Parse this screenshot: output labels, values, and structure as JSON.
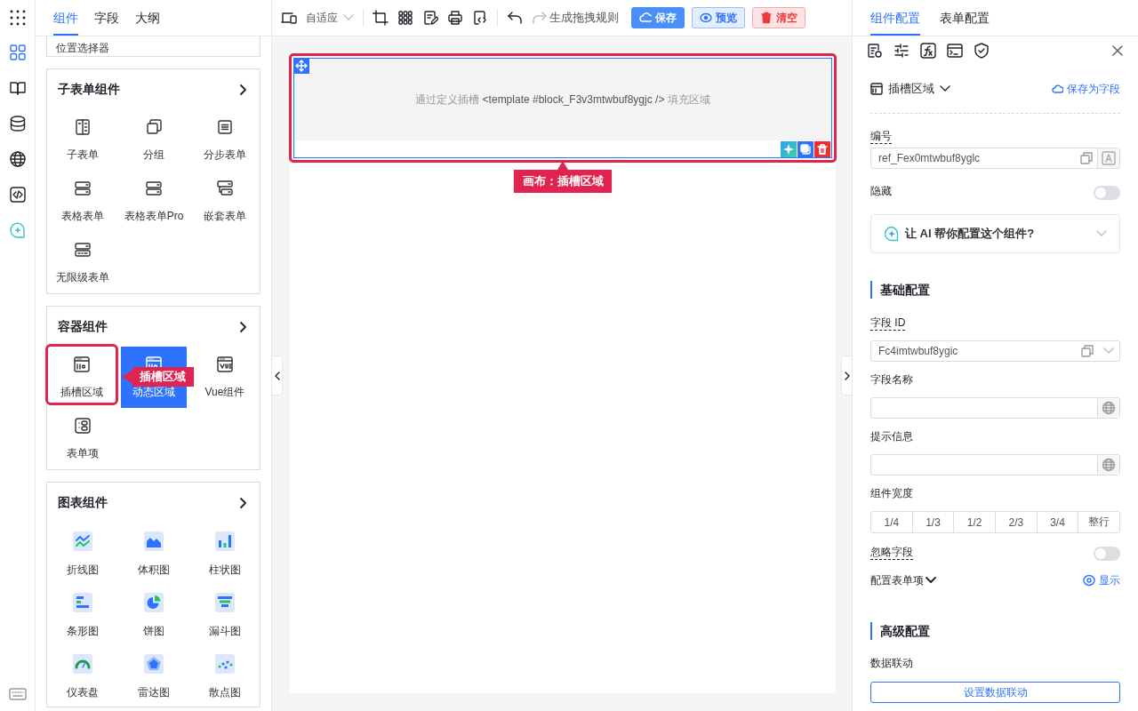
{
  "rail": [
    {
      "selected": true
    },
    {
      "selected": false
    },
    {
      "selected": false
    },
    {
      "selected": false
    },
    {
      "selected": false
    },
    {
      "selected": false
    }
  ],
  "left_tabs": [
    {
      "label": "组件",
      "selected": true
    },
    {
      "label": "字段",
      "selected": false
    },
    {
      "label": "大纲",
      "selected": false
    }
  ],
  "partial_card": {
    "label": "位置选择器"
  },
  "groups": [
    {
      "title": "子表单组件",
      "items": [
        {
          "label": "子表单",
          "selected": false
        },
        {
          "label": "分组",
          "selected": false
        },
        {
          "label": "分步表单",
          "selected": false
        },
        {
          "label": "表格表单",
          "selected": false
        },
        {
          "label": "表格表单Pro",
          "selected": false
        },
        {
          "label": "嵌套表单",
          "selected": false
        },
        {
          "label": "无限级表单",
          "selected": false
        }
      ]
    },
    {
      "title": "容器组件",
      "items": [
        {
          "label": "插槽区域",
          "selected": false,
          "callout": "插槽区域"
        },
        {
          "label": "动态区域",
          "selected": true
        },
        {
          "label": "Vue组件",
          "selected": false
        },
        {
          "label": "表单项",
          "selected": false
        }
      ]
    },
    {
      "title": "图表组件",
      "items": [
        {
          "label": "折线图",
          "selected": false
        },
        {
          "label": "体积图",
          "selected": false
        },
        {
          "label": "柱状图",
          "selected": false
        },
        {
          "label": "条形图",
          "selected": false
        },
        {
          "label": "饼图",
          "selected": false
        },
        {
          "label": "漏斗图",
          "selected": false
        },
        {
          "label": "仪表盘",
          "selected": false
        },
        {
          "label": "雷达图",
          "selected": false
        },
        {
          "label": "散点图",
          "selected": false
        }
      ]
    }
  ],
  "toolbar": {
    "view_mode": "自适应",
    "redo_disabled": true,
    "rule_label": "生成拖拽规则",
    "buttons": [
      {
        "kind": "primary",
        "label": "保存"
      },
      {
        "kind": "info",
        "label": "预览"
      },
      {
        "kind": "danger",
        "label": "清空"
      }
    ]
  },
  "canvas": {
    "block": {
      "hint": [
        "通过定义插槽",
        "<template #block_F3v3mtwbuf8ygjc />",
        "填充区域"
      ],
      "callout": "画布：插槽区域"
    }
  },
  "right_tabs": [
    {
      "label": "组件配置",
      "selected": true
    },
    {
      "label": "表单配置",
      "selected": false
    }
  ],
  "config": {
    "component_name": "插槽区域",
    "save_as_field": "保存为字段",
    "ref": {
      "label": "编号",
      "value": "ref_Fex0mtwbuf8yglc"
    },
    "hidden": {
      "label": "隐藏",
      "on": false
    },
    "ai_prompt": "让 AI 帮你配置这个组件?",
    "basic_title": "基础配置",
    "field_id": {
      "label": "字段 ID",
      "value": "Fc4imtwbuf8ygic"
    },
    "field_name": {
      "label": "字段名称"
    },
    "hint_info": {
      "label": "提示信息"
    },
    "width": {
      "label": "组件宽度",
      "options": [
        {
          "label": "1/4",
          "selected": false
        },
        {
          "label": "1/3",
          "selected": false
        },
        {
          "label": "1/2",
          "selected": false
        },
        {
          "label": "2/3",
          "selected": false
        },
        {
          "label": "3/4",
          "selected": false
        },
        {
          "label": "整行",
          "selected": false
        }
      ]
    },
    "ignore": {
      "label": "忽略字段",
      "on": false
    },
    "form_item": {
      "label": "配置表单项",
      "link": "显示"
    },
    "advanced_title": "高级配置",
    "linkage": {
      "label": "数据联动",
      "button": "设置数据联动"
    }
  }
}
